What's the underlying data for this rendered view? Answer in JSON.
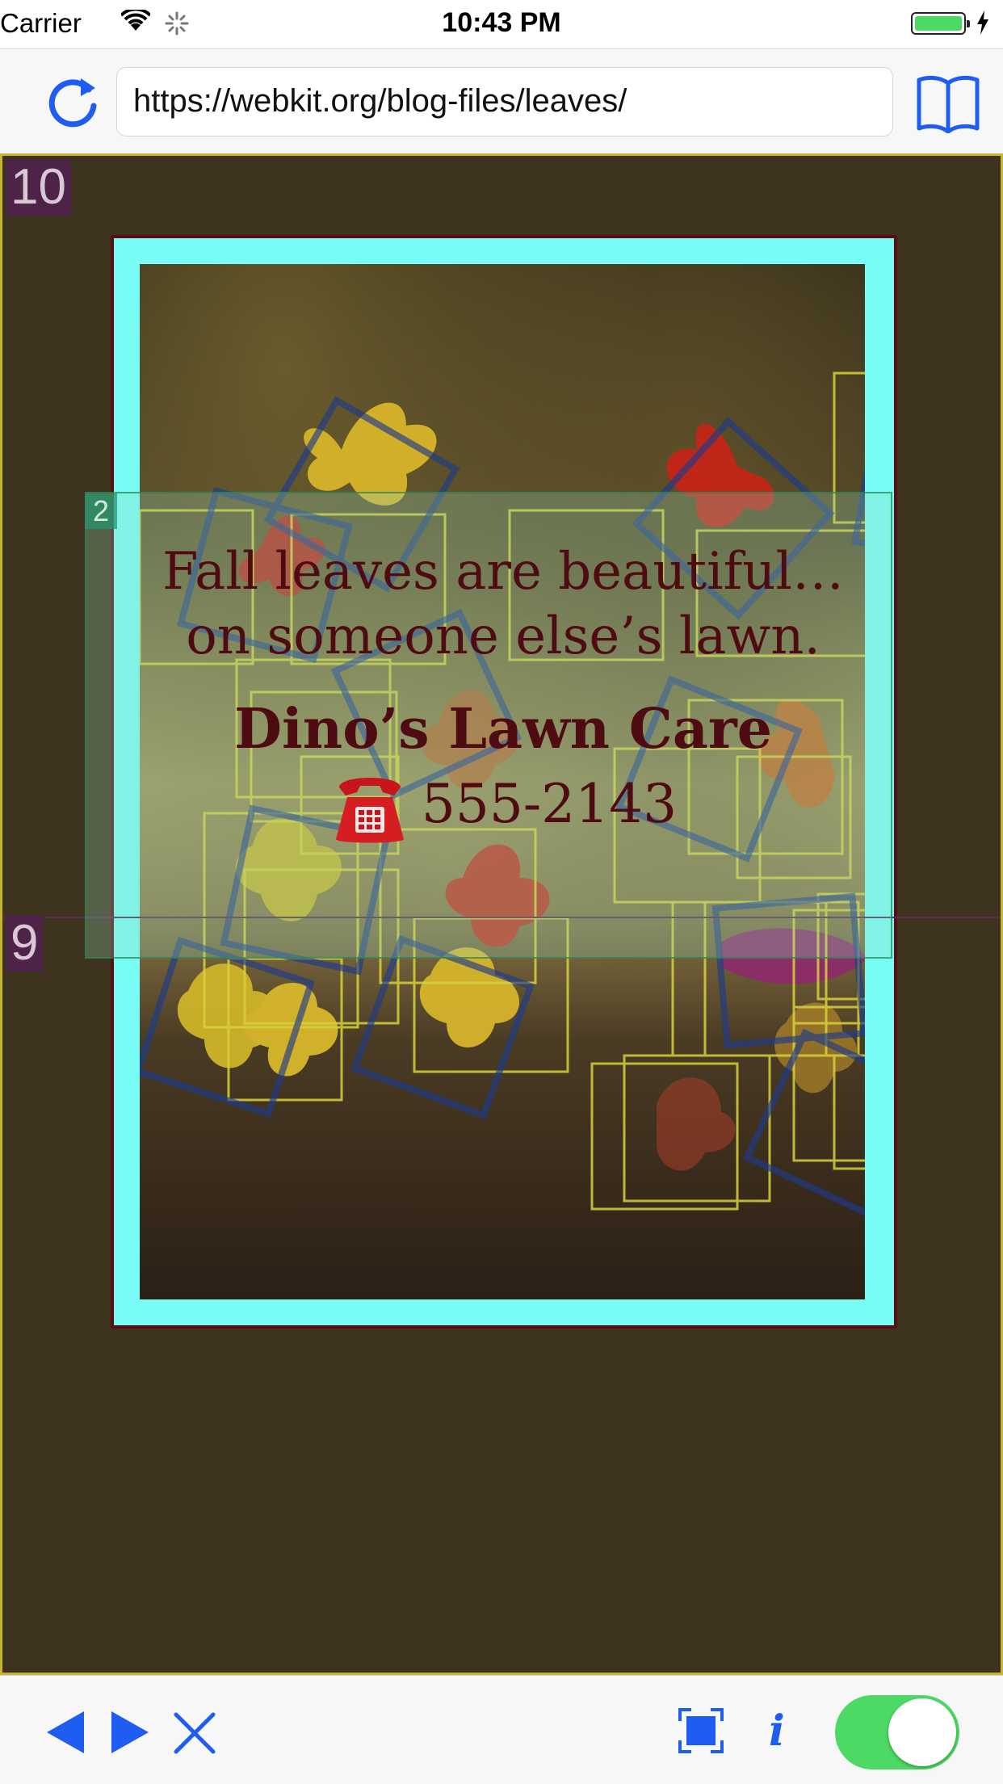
{
  "status_bar": {
    "carrier": "Carrier",
    "time": "10:43 PM",
    "icons": [
      "wifi-icon",
      "activity-spinner-icon",
      "battery-icon",
      "charging-bolt-icon"
    ]
  },
  "url_bar": {
    "url": "https://webkit.org/blog-files/leaves/",
    "icons": [
      "reload-icon",
      "bookmarks-book-icon"
    ]
  },
  "content": {
    "layer_badges": [
      "10",
      "9",
      "2"
    ],
    "poster": {
      "line1": "Fall leaves are beautiful…",
      "line2": "on someone else’s lawn.",
      "business": "Dino’s Lawn Care",
      "phone": "555-2143",
      "phone_icon": "telephone-icon"
    }
  },
  "toolbar": {
    "items": [
      "back-arrow-icon",
      "forward-arrow-icon",
      "stop-x-icon",
      "fit-screen-icon",
      "info-icon",
      "toggle-switch"
    ],
    "info_glyph": "i",
    "toggle_on": true
  },
  "colors": {
    "accent": "#1e5cf2",
    "toggle": "#4cd964",
    "content_bg": "#3d331e",
    "frame_cyan": "#78fdf6",
    "text_maroon": "#4e0c12"
  }
}
